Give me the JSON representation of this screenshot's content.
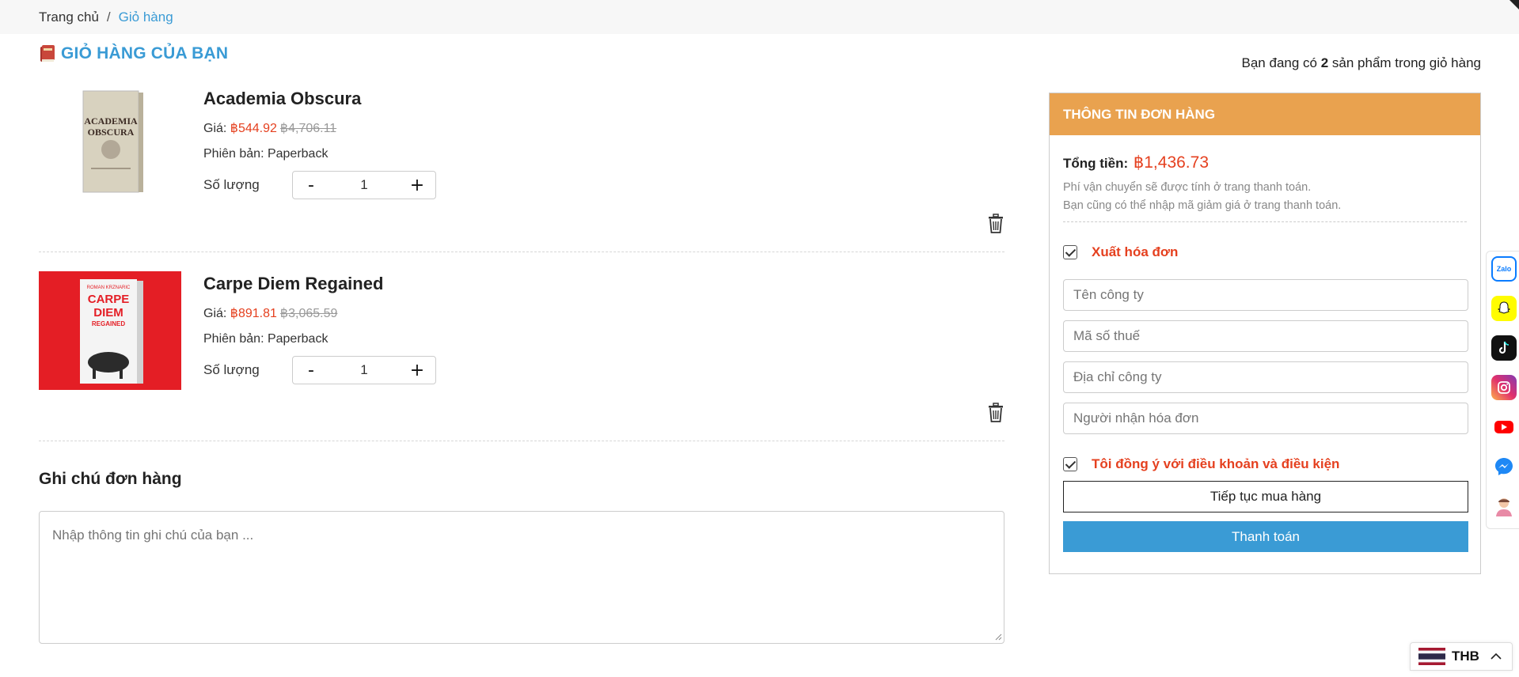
{
  "breadcrumb": {
    "home": "Trang chủ",
    "separator": "/",
    "current": "Giỏ hàng"
  },
  "cart": {
    "title": "GIỎ HÀNG CỦA BẠN",
    "count_prefix": "Bạn đang có ",
    "count": "2",
    "count_suffix": " sản phẩm trong giỏ hàng"
  },
  "items": [
    {
      "name": "Academia Obscura",
      "price_label": "Giá: ",
      "price": "฿544.92",
      "old_price": "฿4,706.11",
      "edition_label": "Phiên bản: ",
      "edition": "Paperback",
      "qty_label": "Số lượng",
      "qty": "1",
      "cover_text": "ACADEMIA OBSCURA"
    },
    {
      "name": "Carpe Diem Regained",
      "price_label": "Giá: ",
      "price": "฿891.81",
      "old_price": "฿3,065.59",
      "edition_label": "Phiên bản: ",
      "edition": "Paperback",
      "qty_label": "Số lượng",
      "qty": "1",
      "cover_author": "ROMAN KRZNARIC",
      "cover_text": "CARPE DIEM REGAINED"
    }
  ],
  "qty_buttons": {
    "minus": "-",
    "plus": "+"
  },
  "note": {
    "title": "Ghi chú đơn hàng",
    "placeholder": "Nhập thông tin ghi chú của bạn ..."
  },
  "order": {
    "header": "THÔNG TIN ĐƠN HÀNG",
    "total_label": "Tổng tiền:",
    "total": "฿1,436.73",
    "shipping_note": "Phí vận chuyển sẽ được tính ở trang thanh toán.",
    "discount_note": "Bạn cũng có thể nhập mã giảm giá ở trang thanh toán.",
    "invoice_label": "Xuất hóa đơn",
    "fields": {
      "company": "Tên công ty",
      "tax": "Mã số thuế",
      "address": "Địa chỉ công ty",
      "receiver": "Người nhận hóa đơn"
    },
    "terms_label": "Tôi đồng ý với điều khoản và điều kiện",
    "continue": "Tiếp tục mua hàng",
    "pay": "Thanh toán"
  },
  "social": {
    "zalo": "Zalo"
  },
  "currency": {
    "code": "THB"
  },
  "colors": {
    "accent": "#3a9bd5",
    "price": "#e5401f",
    "order_header": "#e9a24f"
  }
}
